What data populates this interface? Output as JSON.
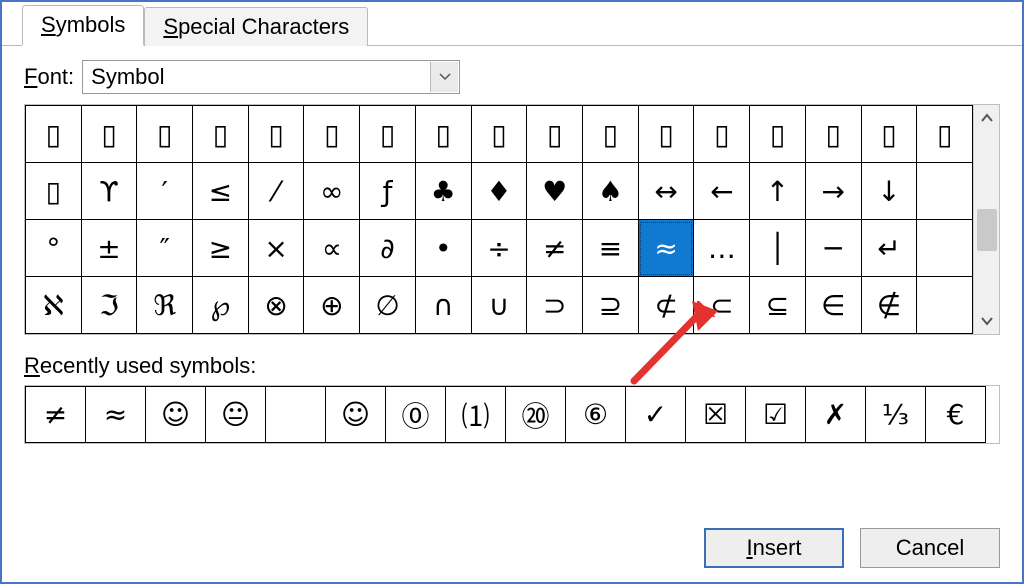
{
  "tabs": {
    "symbols_pre": "S",
    "symbols_post": "ymbols",
    "special_pre": "S",
    "special_post": "pecial Characters"
  },
  "font": {
    "label_pre": "F",
    "label_post": "ont:",
    "value": "Symbol"
  },
  "grid": {
    "cols": 17,
    "rows": [
      [
        "▯",
        "▯",
        "▯",
        "▯",
        "▯",
        "▯",
        "▯",
        "▯",
        "▯",
        "▯",
        "▯",
        "▯",
        "▯",
        "▯",
        "▯",
        "▯",
        "▯"
      ],
      [
        "▯",
        "ϒ",
        "′",
        "≤",
        "⁄",
        "∞",
        "ƒ",
        "♣",
        "♦",
        "♥",
        "♠",
        "↔",
        "←",
        "↑",
        "→",
        "↓",
        ""
      ],
      [
        "°",
        "±",
        "″",
        "≥",
        "×",
        "∝",
        "∂",
        "•",
        "÷",
        "≠",
        "≡",
        "≈",
        "…",
        "│",
        "─",
        "↵",
        ""
      ],
      [
        "ℵ",
        "ℑ",
        "ℜ",
        "℘",
        "⊗",
        "⊕",
        "∅",
        "∩",
        "∪",
        "⊃",
        "⊇",
        "⊄",
        "⊂",
        "⊆",
        "∈",
        "∉",
        ""
      ]
    ],
    "selected_row": 2,
    "selected_col": 11
  },
  "recent": {
    "label_pre": "R",
    "label_post": "ecently used symbols:",
    "items": [
      "≠",
      "≈",
      "☺",
      "😐",
      "",
      "☺",
      "⓪",
      "⑴",
      "⑳",
      "⑥",
      "✓",
      "☒",
      "☑",
      "✗",
      "⅓",
      "€"
    ]
  },
  "buttons": {
    "insert_pre": "I",
    "insert_post": "nsert",
    "cancel": "Cancel"
  }
}
